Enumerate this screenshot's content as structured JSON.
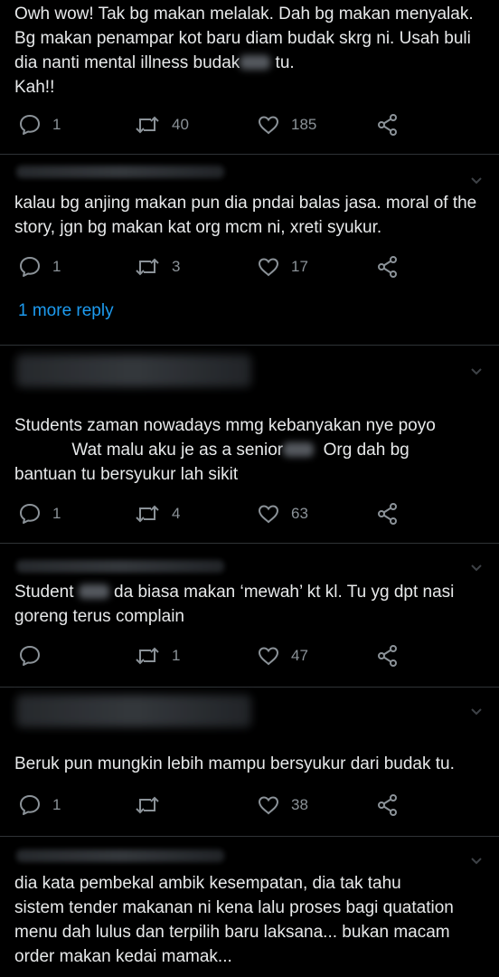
{
  "tweets": [
    {
      "text_parts": [
        "Owh wow! Tak bg makan melalak. Dah bg makan menyalak. Bg makan penampar kot baru diam budak skrg ni. Usah buli dia nanti mental illness budak",
        " tu.\nKah!!"
      ],
      "replies": "1",
      "retweets": "40",
      "likes": "185"
    },
    {
      "text": "kalau bg anjing makan pun dia pndai balas jasa. moral of the story, jgn bg makan kat org mcm ni, xreti syukur.",
      "replies": "1",
      "retweets": "3",
      "likes": "17",
      "more_replies": "1 more reply"
    },
    {
      "text_parts": [
        "Students zaman nowadays mmg kebanyakan nye poyo\n            Wat malu aku je as a senior",
        "  Org dah bg\nbantuan tu bersyukur lah sikit"
      ],
      "replies": "1",
      "retweets": "4",
      "likes": "63"
    },
    {
      "text_parts": [
        "Student",
        " da biasa makan ‘mewah’ kt kl. Tu yg dpt nasi\ngoreng terus complain"
      ],
      "replies": "",
      "retweets": "1",
      "likes": "47"
    },
    {
      "text": "Beruk pun mungkin lebih mampu bersyukur dari budak tu.",
      "replies": "1",
      "retweets": "",
      "likes": "38"
    },
    {
      "text": "dia kata pembekal ambik kesempatan, dia tak tahu\nsistem tender makanan ni kena lalu proses bagi quatation\nmenu dah lulus dan terpilih baru laksana... bukan macam\norder makan kedai mamak..."
    }
  ],
  "colors": {
    "background": "#000000",
    "text": "#e7e9ea",
    "muted": "#8b9298",
    "link": "#1d9bf0",
    "divider": "#2f3336"
  },
  "icons": [
    "reply-icon",
    "retweet-icon",
    "like-icon",
    "share-icon",
    "chevron-down-icon"
  ]
}
